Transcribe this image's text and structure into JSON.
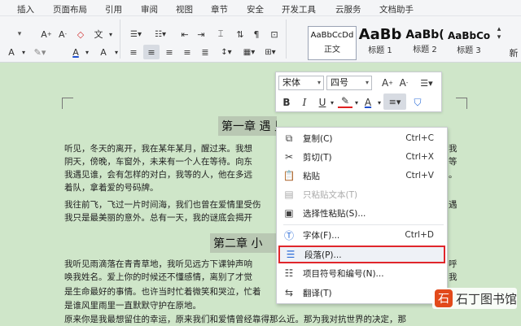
{
  "menu_tabs": [
    "插入",
    "页面布局",
    "引用",
    "审阅",
    "视图",
    "章节",
    "安全",
    "开发工具",
    "云服务",
    "文档助手"
  ],
  "styles": [
    {
      "preview": "AaBbCcDd",
      "caption": "正文"
    },
    {
      "preview": "AaBb",
      "caption": "标题 1"
    },
    {
      "preview": "AaBb(",
      "caption": "标题 2"
    },
    {
      "preview": "AaBbCo",
      "caption": "标题 3"
    }
  ],
  "styles_more_label": "新",
  "mini_toolbar": {
    "font": "宋体",
    "size": "四号"
  },
  "document": {
    "heading1": "第一章   遇 见",
    "heading2": "第二章   小",
    "lines": [
      "听见，冬天的离开，我在某年某月，醒过来。我想",
      "阴天，傍晚，车窗外，未来有一个人在等待。向东",
      "我遇见谁，会有怎样的对白，我等的人，他在多远",
      "着队，拿着爱的号码牌。",
      "我往前飞，飞过一片时间海，我们也曾在爱情里受伤",
      "我只是最美丽的意外。总有一天，我的谜底会揭开",
      "我听见雨滴落在青青草地，我听见远方下课钟声响",
      "唤我姓名。爱上你的时候还不懂感情，离别了才觉",
      "是生命最好的事情。也许当时忙着微笑和哭泣，忙着",
      "是谁风里雨里一直默默守护在原地。",
      "原来你是我最想留住的幸运，原来我们和爱情曾经靠得那么近。那为我对抗世界的决定，那"
    ],
    "right_fragments": [
      "我",
      "等",
      "。",
      "遇",
      "呼",
      "我"
    ]
  },
  "context_menu": {
    "items": [
      {
        "label": "复制(C)",
        "shortcut": "Ctrl+C",
        "icon": "copy-icon",
        "disabled": false
      },
      {
        "label": "剪切(T)",
        "shortcut": "Ctrl+X",
        "icon": "scissors-icon",
        "disabled": false
      },
      {
        "label": "粘贴",
        "shortcut": "Ctrl+V",
        "icon": "paste-icon",
        "disabled": false
      },
      {
        "label": "只粘贴文本(T)",
        "shortcut": "",
        "icon": "paste-text-icon",
        "disabled": true
      },
      {
        "label": "选择性粘贴(S)...",
        "shortcut": "",
        "icon": "paste-special-icon",
        "disabled": false
      },
      {
        "label": "字体(F)...",
        "shortcut": "Ctrl+D",
        "icon": "font-icon",
        "disabled": false
      },
      {
        "label": "段落(P)...",
        "shortcut": "",
        "icon": "paragraph-icon",
        "disabled": false
      },
      {
        "label": "项目符号和编号(N)...",
        "shortcut": "",
        "icon": "bullets-icon",
        "disabled": false
      },
      {
        "label": "翻译(T)",
        "shortcut": "",
        "icon": "translate-icon",
        "disabled": false
      }
    ]
  },
  "watermark": {
    "logo": "石",
    "text": "石丁图书馆"
  },
  "colors": {
    "page_bg": "#cfe6c9",
    "highlight_border": "#e0262b",
    "font_color_red": "#e02020",
    "font_color_blue": "#2050d0"
  }
}
